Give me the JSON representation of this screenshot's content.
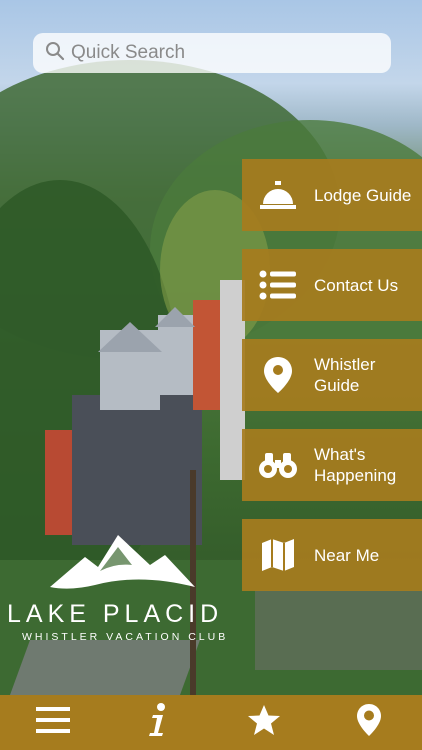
{
  "search": {
    "placeholder": "Quick Search",
    "icon": "search-icon"
  },
  "menu": [
    {
      "label": "Lodge Guide",
      "icon": "service-bell-icon"
    },
    {
      "label": "Contact Us",
      "icon": "list-icon"
    },
    {
      "label": "Whistler\nGuide",
      "icon": "map-pin-icon"
    },
    {
      "label": "What's\nHappening",
      "icon": "binoculars-icon"
    },
    {
      "label": "Near Me",
      "icon": "map-icon"
    }
  ],
  "logo": {
    "name": "LAKE PLACID",
    "subtitle": "WHISTLER VACATION CLUB"
  },
  "bottom_bar": [
    {
      "icon": "hamburger-menu-icon"
    },
    {
      "icon": "info-icon"
    },
    {
      "icon": "star-icon"
    },
    {
      "icon": "location-pin-icon"
    }
  ],
  "colors": {
    "accent": "#a67c1e",
    "text": "#ffffff"
  }
}
